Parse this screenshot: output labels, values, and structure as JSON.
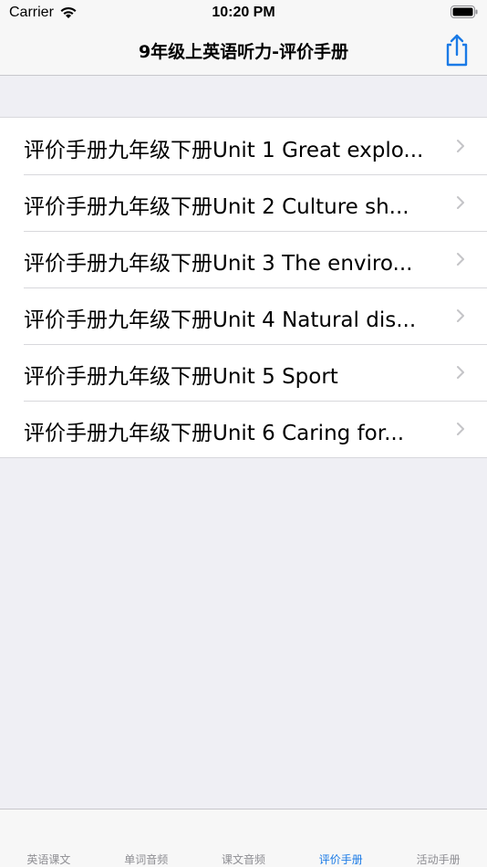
{
  "status_bar": {
    "carrier": "Carrier",
    "time": "10:20 PM"
  },
  "nav": {
    "title": "9年级上英语听力-评价手册",
    "share_icon": "share-icon",
    "accent": "#1a7ae6"
  },
  "list": {
    "items": [
      {
        "label": "评价手册九年级下册Unit 1 Great explo..."
      },
      {
        "label": "评价手册九年级下册Unit 2 Culture sh..."
      },
      {
        "label": "评价手册九年级下册Unit 3 The enviro..."
      },
      {
        "label": "评价手册九年级下册Unit 4 Natural dis..."
      },
      {
        "label": "评价手册九年级下册Unit 5 Sport"
      },
      {
        "label": "评价手册九年级下册Unit 6 Caring for..."
      }
    ]
  },
  "tab_bar": {
    "tabs": [
      {
        "label": "英语课文"
      },
      {
        "label": "单词音频"
      },
      {
        "label": "课文音频"
      },
      {
        "label": "评价手册"
      },
      {
        "label": "活动手册"
      }
    ],
    "active": "评价手册"
  }
}
